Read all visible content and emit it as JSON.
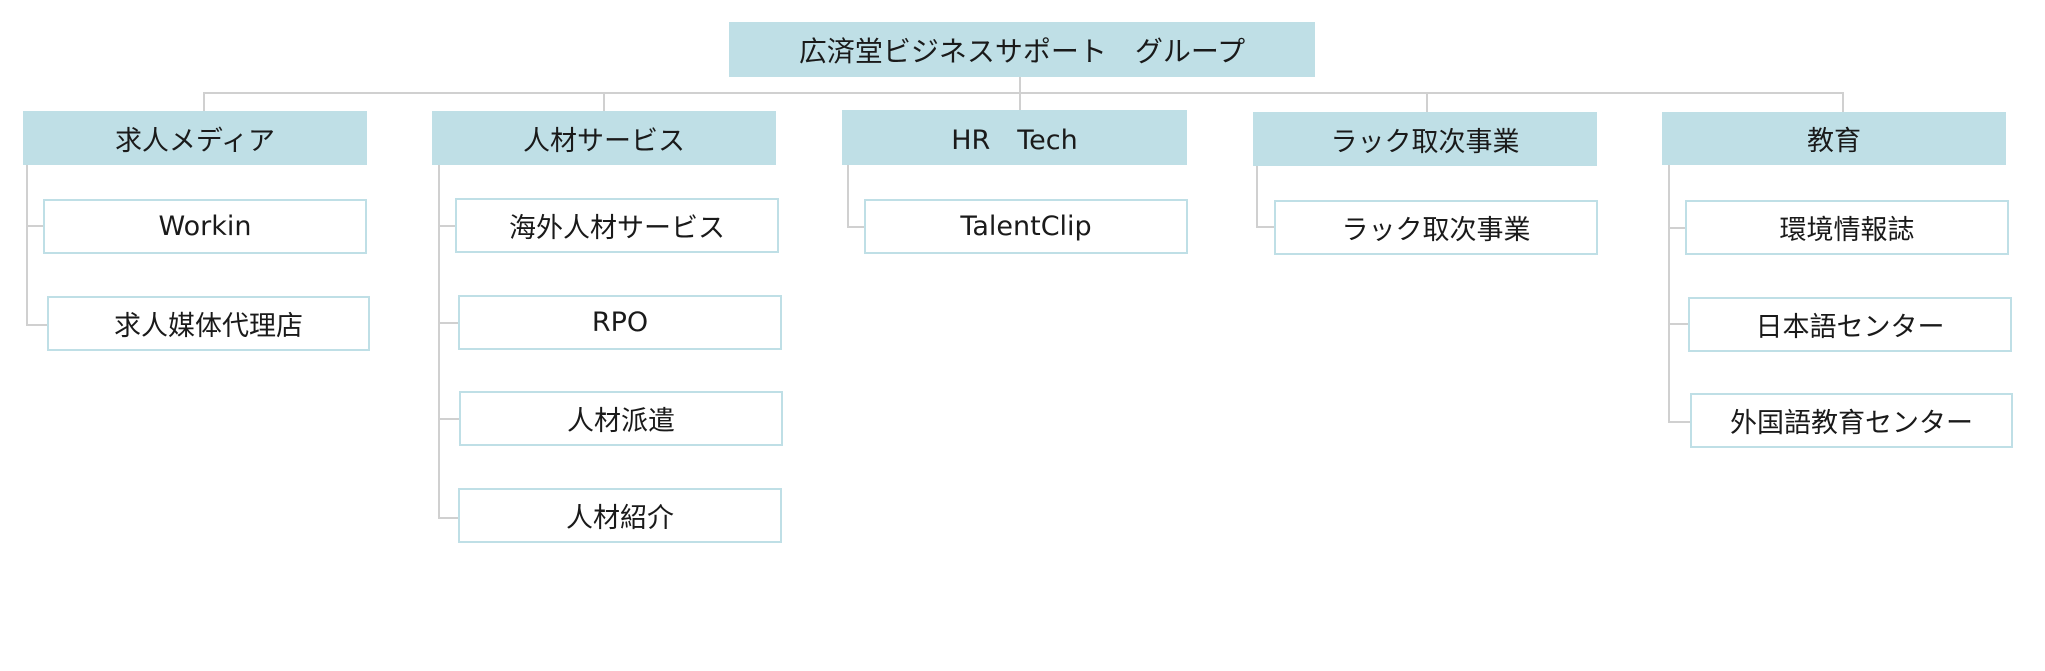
{
  "root": {
    "label": "広済堂ビジネスサポート　グループ"
  },
  "colors": {
    "node_fill": "#bfdfe6",
    "node_border": "#bfdfe6",
    "connector": "#d0d0d0"
  },
  "categories": [
    {
      "label": "求人メディア",
      "children": [
        {
          "label": "Workin"
        },
        {
          "label": "求人媒体代理店"
        }
      ]
    },
    {
      "label": "人材サービス",
      "children": [
        {
          "label": "海外人材サービス"
        },
        {
          "label": "RPO"
        },
        {
          "label": "人材派遣"
        },
        {
          "label": "人材紹介"
        }
      ]
    },
    {
      "label": "HR　Tech",
      "children": [
        {
          "label": "TalentClip"
        }
      ]
    },
    {
      "label": "ラック取次事業",
      "children": [
        {
          "label": "ラック取次事業"
        }
      ]
    },
    {
      "label": "教育",
      "children": [
        {
          "label": "環境情報誌"
        },
        {
          "label": "日本語センター"
        },
        {
          "label": "外国語教育センター"
        }
      ]
    }
  ]
}
